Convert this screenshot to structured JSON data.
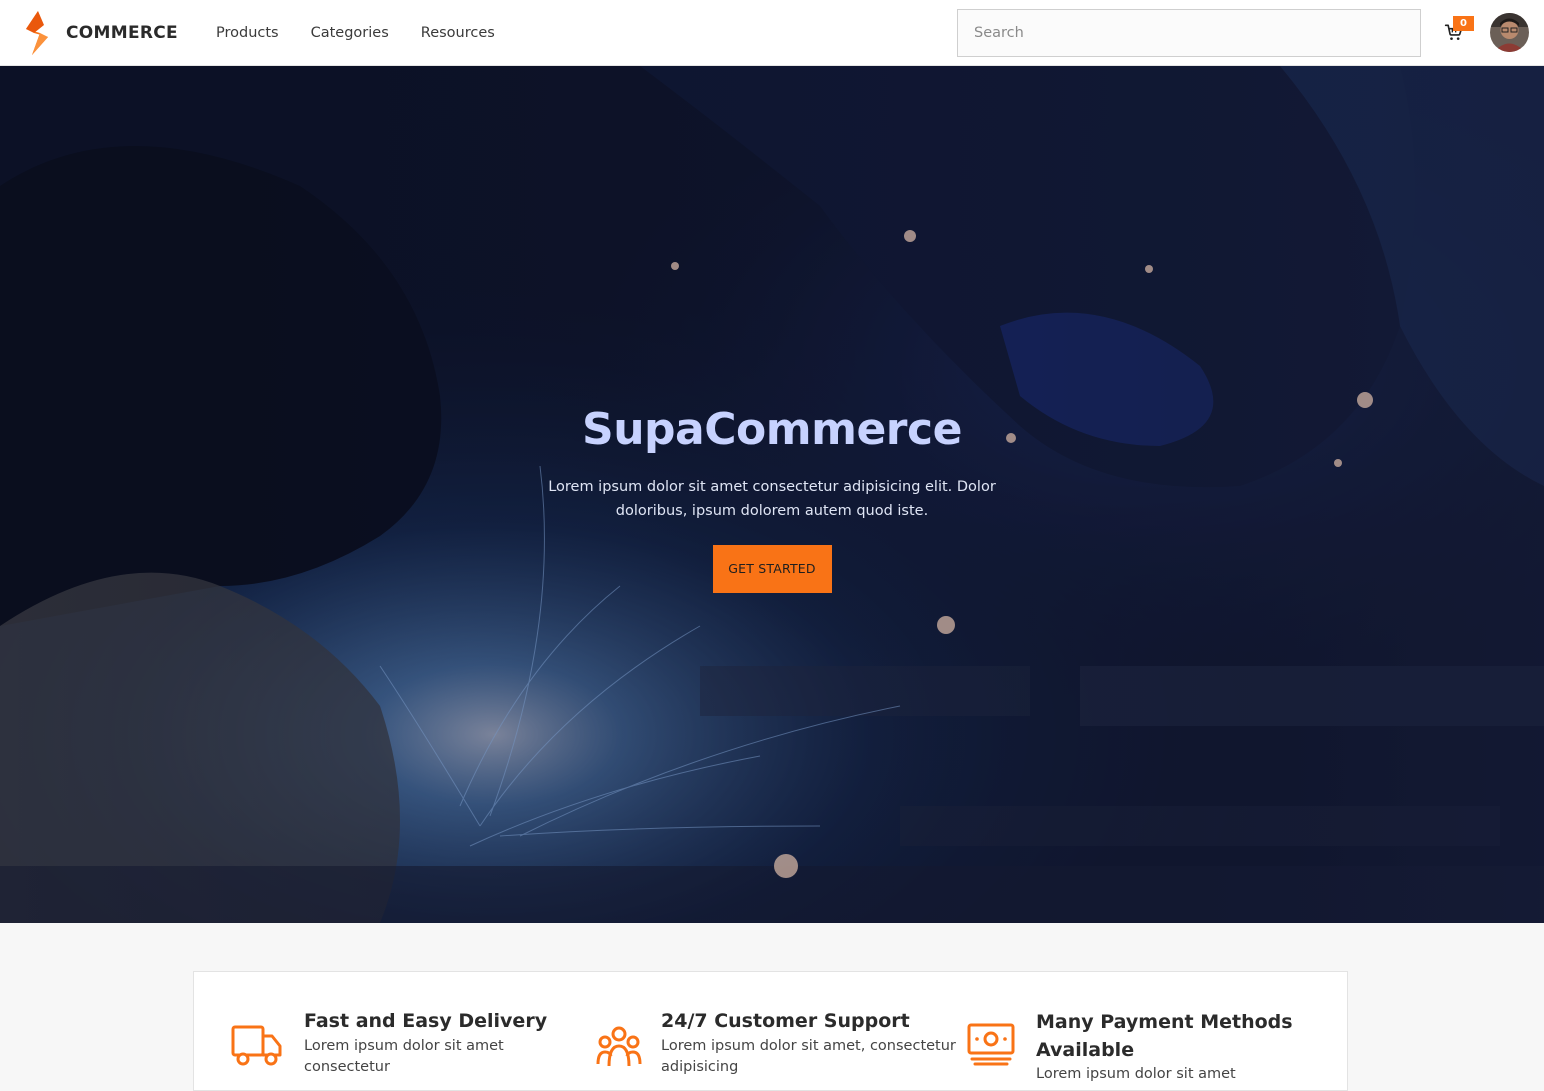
{
  "brand": {
    "name": "COMMERCE",
    "accent": "#f97316"
  },
  "nav": {
    "items": [
      {
        "label": "Products"
      },
      {
        "label": "Categories"
      },
      {
        "label": "Resources"
      }
    ]
  },
  "search": {
    "placeholder": "Search",
    "value": ""
  },
  "cart": {
    "count": "0",
    "icon": "cart-icon"
  },
  "user": {
    "avatar_icon": "user-avatar"
  },
  "hero": {
    "title": "SupaCommerce",
    "description": "Lorem ipsum dolor sit amet consectetur adipisicing elit. Dolor doloribus, ipsum dolorem autem quod iste.",
    "cta_label": "GET STARTED"
  },
  "features": [
    {
      "icon": "truck-icon",
      "title": "Fast and Easy Delivery",
      "description": "Lorem ipsum dolor sit amet consectetur"
    },
    {
      "icon": "users-icon",
      "title": "24/7 Customer Support",
      "description": "Lorem ipsum dolor sit amet, consectetur adipisicing"
    },
    {
      "icon": "banknote-icon",
      "title": "Many Payment Methods Available",
      "description": "Lorem ipsum dolor sit amet"
    }
  ]
}
